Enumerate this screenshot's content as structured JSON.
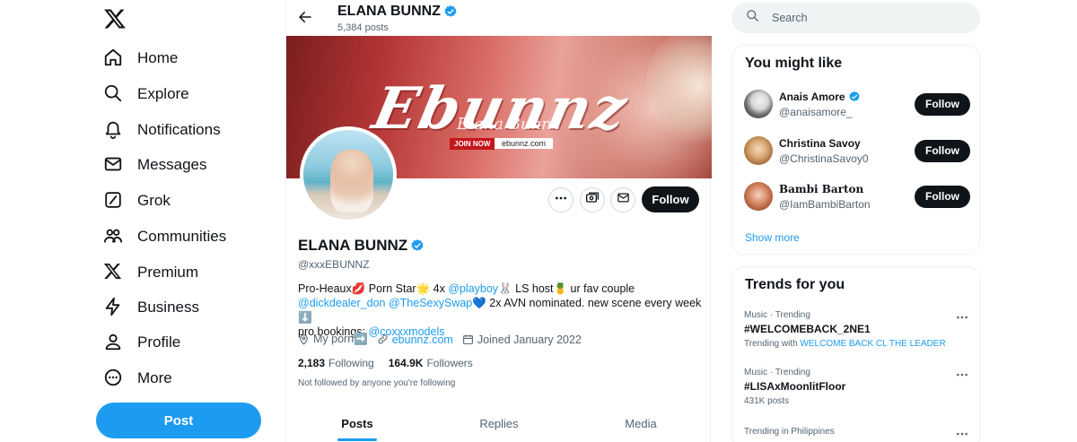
{
  "nav": {
    "items": [
      {
        "label": "Home",
        "icon": "home-icon"
      },
      {
        "label": "Explore",
        "icon": "search-icon"
      },
      {
        "label": "Notifications",
        "icon": "bell-icon"
      },
      {
        "label": "Messages",
        "icon": "mail-icon"
      },
      {
        "label": "Grok",
        "icon": "grok-icon"
      },
      {
        "label": "Communities",
        "icon": "communities-icon"
      },
      {
        "label": "Premium",
        "icon": "x-logo-icon"
      },
      {
        "label": "Business",
        "icon": "lightning-icon"
      },
      {
        "label": "Profile",
        "icon": "person-icon"
      },
      {
        "label": "More",
        "icon": "more-circle-icon"
      }
    ],
    "post_label": "Post"
  },
  "header": {
    "name": "ELANA BUNNZ",
    "post_count": "5,384 posts"
  },
  "banner": {
    "brand": "Ebunnz",
    "subtitle": "Elana Bunnz",
    "join": "JOIN NOW",
    "url": "ebunnz.com"
  },
  "profile": {
    "name": "ELANA BUNNZ",
    "handle": "@xxxEBUNNZ",
    "follow_label": "Follow",
    "bio": {
      "p1": "Pro-Heaux💋 Porn Star🌟 4x ",
      "link1": "@playboy",
      "p2": "🐰 LS host🍍 ur fav couple",
      "link2": "@dickdealer_don",
      "link3": "@TheSexySwap",
      "p3": "💙 2x AVN nominated. new scene every week ⬇️",
      "p4": "pro bookings: ",
      "link4": "@coxxxmodels"
    },
    "location": "My porn➡️",
    "website": "ebunnz.com",
    "joined": "Joined January 2022",
    "following_count": "2,183",
    "following_label": "Following",
    "followers_count": "164.9K",
    "followers_label": "Followers",
    "not_followed": "Not followed by anyone you're following"
  },
  "tabs": [
    {
      "label": "Posts",
      "active": true
    },
    {
      "label": "Replies",
      "active": false
    },
    {
      "label": "Media",
      "active": false
    }
  ],
  "search": {
    "placeholder": "Search"
  },
  "suggestions": {
    "title": "You might like",
    "items": [
      {
        "name": "Anais Amore",
        "handle": "@anaisamore_",
        "verified": true,
        "follow_label": "Follow"
      },
      {
        "name": "Christina Savoy",
        "handle": "@ChristinaSavoy0",
        "verified": false,
        "follow_label": "Follow"
      },
      {
        "name": "Bambi Barton",
        "handle": "@IamBambiBarton",
        "verified": false,
        "follow_label": "Follow"
      }
    ],
    "show_more": "Show more"
  },
  "trends": {
    "title": "Trends for you",
    "items": [
      {
        "context": "Music · Trending",
        "title": "#WELCOMEBACK_2NE1",
        "extra_prefix": "Trending with ",
        "extra_link": "WELCOME BACK CL THE LEADER"
      },
      {
        "context": "Music · Trending",
        "title": "#LISAxMoonlitFloor",
        "extra_prefix": "431K posts",
        "extra_link": ""
      },
      {
        "context": "Trending in Philippines",
        "title": "",
        "extra_prefix": "",
        "extra_link": ""
      }
    ]
  },
  "colors": {
    "accent": "#1d9bf0",
    "text": "#0f1419",
    "muted": "#536471",
    "button_dark": "#0f1419"
  }
}
